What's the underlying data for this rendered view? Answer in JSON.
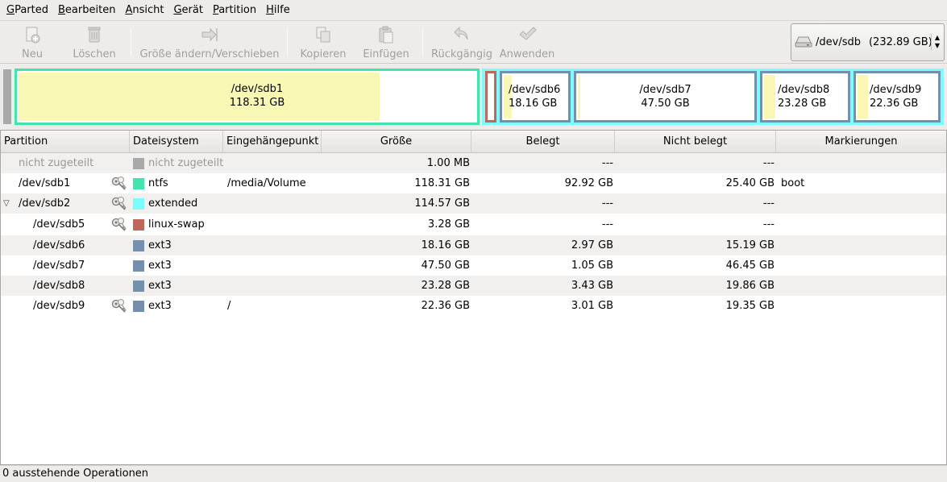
{
  "menu": {
    "gparted": {
      "first": "G",
      "rest": "Parted"
    },
    "bearbeiten": {
      "first": "B",
      "rest": "earbeiten"
    },
    "ansicht": {
      "first": "A",
      "rest": "nsicht"
    },
    "geraet": {
      "first": "G",
      "rest": "erät"
    },
    "partition": {
      "first": "P",
      "rest": "artition"
    },
    "hilfe": {
      "first": "H",
      "rest": "ilfe"
    }
  },
  "toolbar": {
    "new_label": "Neu",
    "delete_label": "Löschen",
    "resize_label": "Größe ändern/Verschieben",
    "copy_label": "Kopieren",
    "paste_label": "Einfügen",
    "undo_label": "Rückgängig",
    "apply_label": "Anwenden"
  },
  "device": {
    "name": "/dev/sdb",
    "size": "(232.89 GB)"
  },
  "diskmap": {
    "sdb1": {
      "name": "/dev/sdb1",
      "size": "118.31 GB",
      "used_fraction": 0.785
    },
    "sdb6": {
      "name": "/dev/sdb6",
      "size": "18.16 GB"
    },
    "sdb7": {
      "name": "/dev/sdb7",
      "size": "47.50 GB"
    },
    "sdb8": {
      "name": "/dev/sdb8",
      "size": "23.28 GB"
    },
    "sdb9": {
      "name": "/dev/sdb9",
      "size": "22.36 GB"
    }
  },
  "colors": {
    "ntfs": "#42e5ac",
    "extended": "#7dfcfe",
    "linux_swap": "#c1665a",
    "ext3": "#7590ae",
    "unallocated": "#a9a9a9",
    "used": "#f8f8b4"
  },
  "table": {
    "headers": {
      "partition": "Partition",
      "filesystem": "Dateisystem",
      "mountpoint": "Eingehängepunkt",
      "size": "Größe",
      "used": "Belegt",
      "unused": "Nicht belegt",
      "flags": "Markierungen"
    },
    "rows": [
      {
        "partition": "nicht zugeteilt",
        "filesystem": "nicht zugeteilt",
        "mount": "",
        "size": "1.00 MB",
        "used": "---",
        "unused": "---",
        "flags": ""
      },
      {
        "partition": "/dev/sdb1",
        "filesystem": "ntfs",
        "mount": "/media/Volume",
        "size": "118.31 GB",
        "used": "92.92 GB",
        "unused": "25.40 GB",
        "flags": "boot"
      },
      {
        "partition": "/dev/sdb2",
        "filesystem": "extended",
        "mount": "",
        "size": "114.57 GB",
        "used": "---",
        "unused": "---",
        "flags": ""
      },
      {
        "partition": "/dev/sdb5",
        "filesystem": "linux-swap",
        "mount": "",
        "size": "3.28 GB",
        "used": "---",
        "unused": "---",
        "flags": ""
      },
      {
        "partition": "/dev/sdb6",
        "filesystem": "ext3",
        "mount": "",
        "size": "18.16 GB",
        "used": "2.97 GB",
        "unused": "15.19 GB",
        "flags": ""
      },
      {
        "partition": "/dev/sdb7",
        "filesystem": "ext3",
        "mount": "",
        "size": "47.50 GB",
        "used": "1.05 GB",
        "unused": "46.45 GB",
        "flags": ""
      },
      {
        "partition": "/dev/sdb8",
        "filesystem": "ext3",
        "mount": "",
        "size": "23.28 GB",
        "used": "3.43 GB",
        "unused": "19.86 GB",
        "flags": ""
      },
      {
        "partition": "/dev/sdb9",
        "filesystem": "ext3",
        "mount": "/",
        "size": "22.36 GB",
        "used": "3.01 GB",
        "unused": "19.35 GB",
        "flags": ""
      }
    ]
  },
  "status": {
    "pending": "0 ausstehende Operationen"
  }
}
